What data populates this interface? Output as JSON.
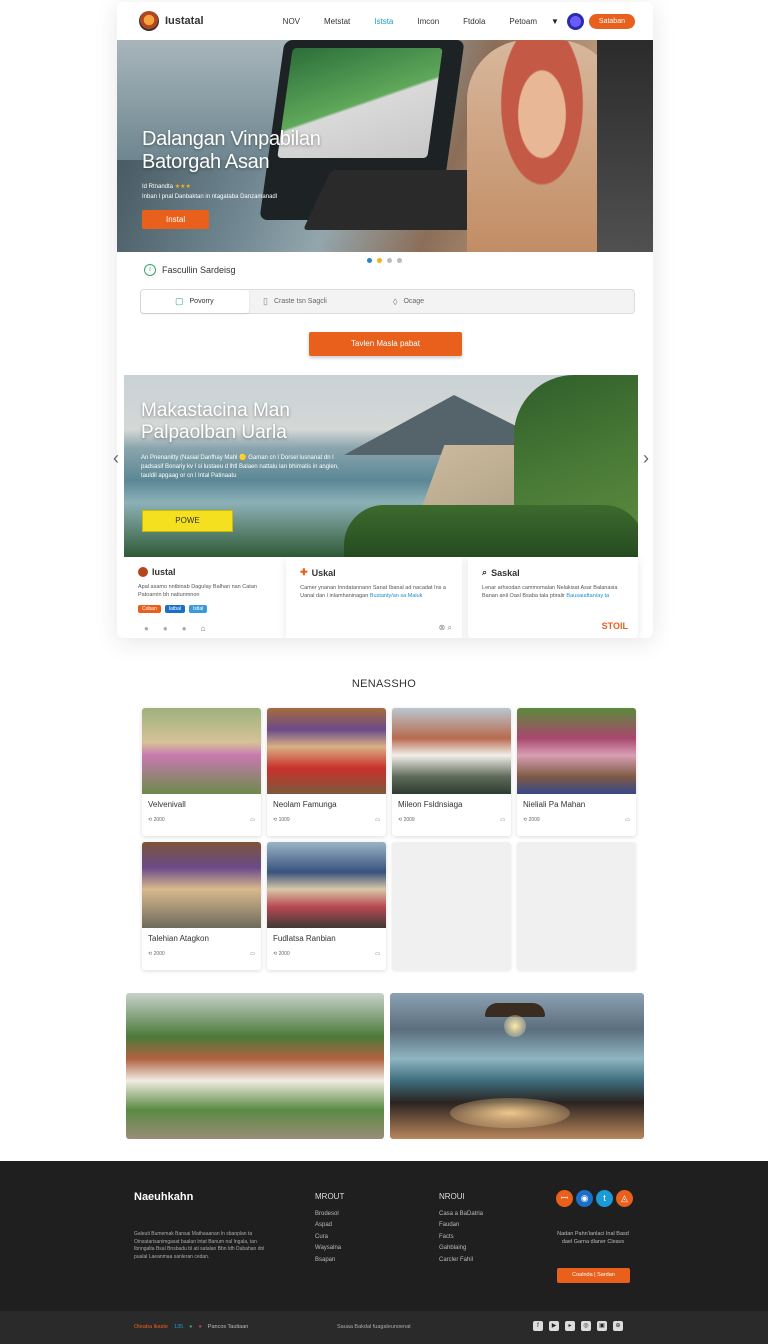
{
  "header": {
    "brand": "Iustatal",
    "nav": [
      "NOV",
      "Metstat",
      "Iststa",
      "Imcon",
      "Ftdola",
      "Petoam"
    ],
    "cta": "Sataban"
  },
  "hero": {
    "title_line1": "Dalangan Vinpabilan",
    "title_line2": "Batorgah Asan",
    "meta_line1": "Id Rtnandta",
    "stars": "★★★",
    "meta_line2": "Inban l pnal Danbaktan in ntagataba Danzamanadl",
    "button": "Instal"
  },
  "search": {
    "label": "Fascullin Sardeisg",
    "tabs": [
      {
        "label": "Povorry",
        "icon": "▢"
      },
      {
        "label": "Craste tsn Sagcli",
        "icon": "▯"
      },
      {
        "label": "Ocage",
        "icon": "◊"
      }
    ],
    "cta": "Tavlen Masla pabat"
  },
  "banner": {
    "title_line1": "Makastacina Man",
    "title_line2": "Palpaolban Uarla",
    "desc": "An Pnenanitty (Nasial Danfhay Mahl 🟡 Gaman cn l Dorsel lusnanat dn l padsasif Bonariy kv l si lustaeu d lhtl Balaen nattalu lan bhimatis in anglen, tauldil apgaag or cn l Intal Patinaatu",
    "button": "POWE"
  },
  "cards": [
    {
      "title": "Iustal",
      "desc": "Apal asamo nntbinab Dagulay Balhan nan Catan Patoarnin bh natiunmnon",
      "link": "",
      "tags": [
        "Coban",
        "Iatbal",
        "Istlal"
      ]
    },
    {
      "title": "Uskal",
      "desc": "Camer ynanan Inndatannann Sanat Ibanal ad nacadat Ins a Uanal dan l inlamhaninagan",
      "link": "Bustanty/an sa Maluk",
      "tags": []
    },
    {
      "title": "Saskal",
      "desc": "Lenar arhsodan cammomalan Nelakisat Asar Balanasia Banan anil Oasl Bsaba tala ptiralir",
      "link": "Bausaudtan/ay ta",
      "tags": [],
      "cta": "STOIL"
    }
  ],
  "gallery": {
    "title": "NENASSHO",
    "items": [
      {
        "name": "Velvenivall",
        "count": "2000"
      },
      {
        "name": "Neolam Famunga",
        "count": "1009"
      },
      {
        "name": "Mileon Fsldnsiaga",
        "count": "2009"
      },
      {
        "name": "Nieliali Pa Mahan",
        "count": "2009"
      },
      {
        "name": "Talehian Atagkon",
        "count": "2000"
      },
      {
        "name": "Fudlatsa Ranbian",
        "count": "2000"
      }
    ]
  },
  "footer": {
    "brand": "Naeuhkahn",
    "about": "Galeuti Bumemak Bansai Mathaaanan ln sbanplan ta Oinsatarisanimgasat baalan lntat Banum nal Ingala, tan Ibnngalta Bsal Bnsbadu bl ati satalan Bbn ldh Dabahan dnl pualal Laeanmaa sanleran cedan.",
    "col1_title": "MROUT",
    "col1": [
      "Brodesol",
      "Aspad",
      "Cura",
      "Waysalna",
      "Bsapan"
    ],
    "col2_title": "NROUI",
    "col2": [
      "Casa a BaDatria",
      "Faudan",
      "Facts",
      "Gahblaing",
      "Carcler Fahil"
    ],
    "contact": "Nadan Pahn'ianlaci Inal Basd dael Garna dlaner Cleavs",
    "button": "Coalnda | Sardan",
    "social": [
      "ꟷ",
      "◉",
      "t",
      "◬"
    ]
  },
  "bottombar": {
    "left": "Oteaba lkaste",
    "left_mid": "135",
    "left_end": "Pancos Tautiaan",
    "mid": "Sauaa Bakdal fuagaleunoenat"
  }
}
